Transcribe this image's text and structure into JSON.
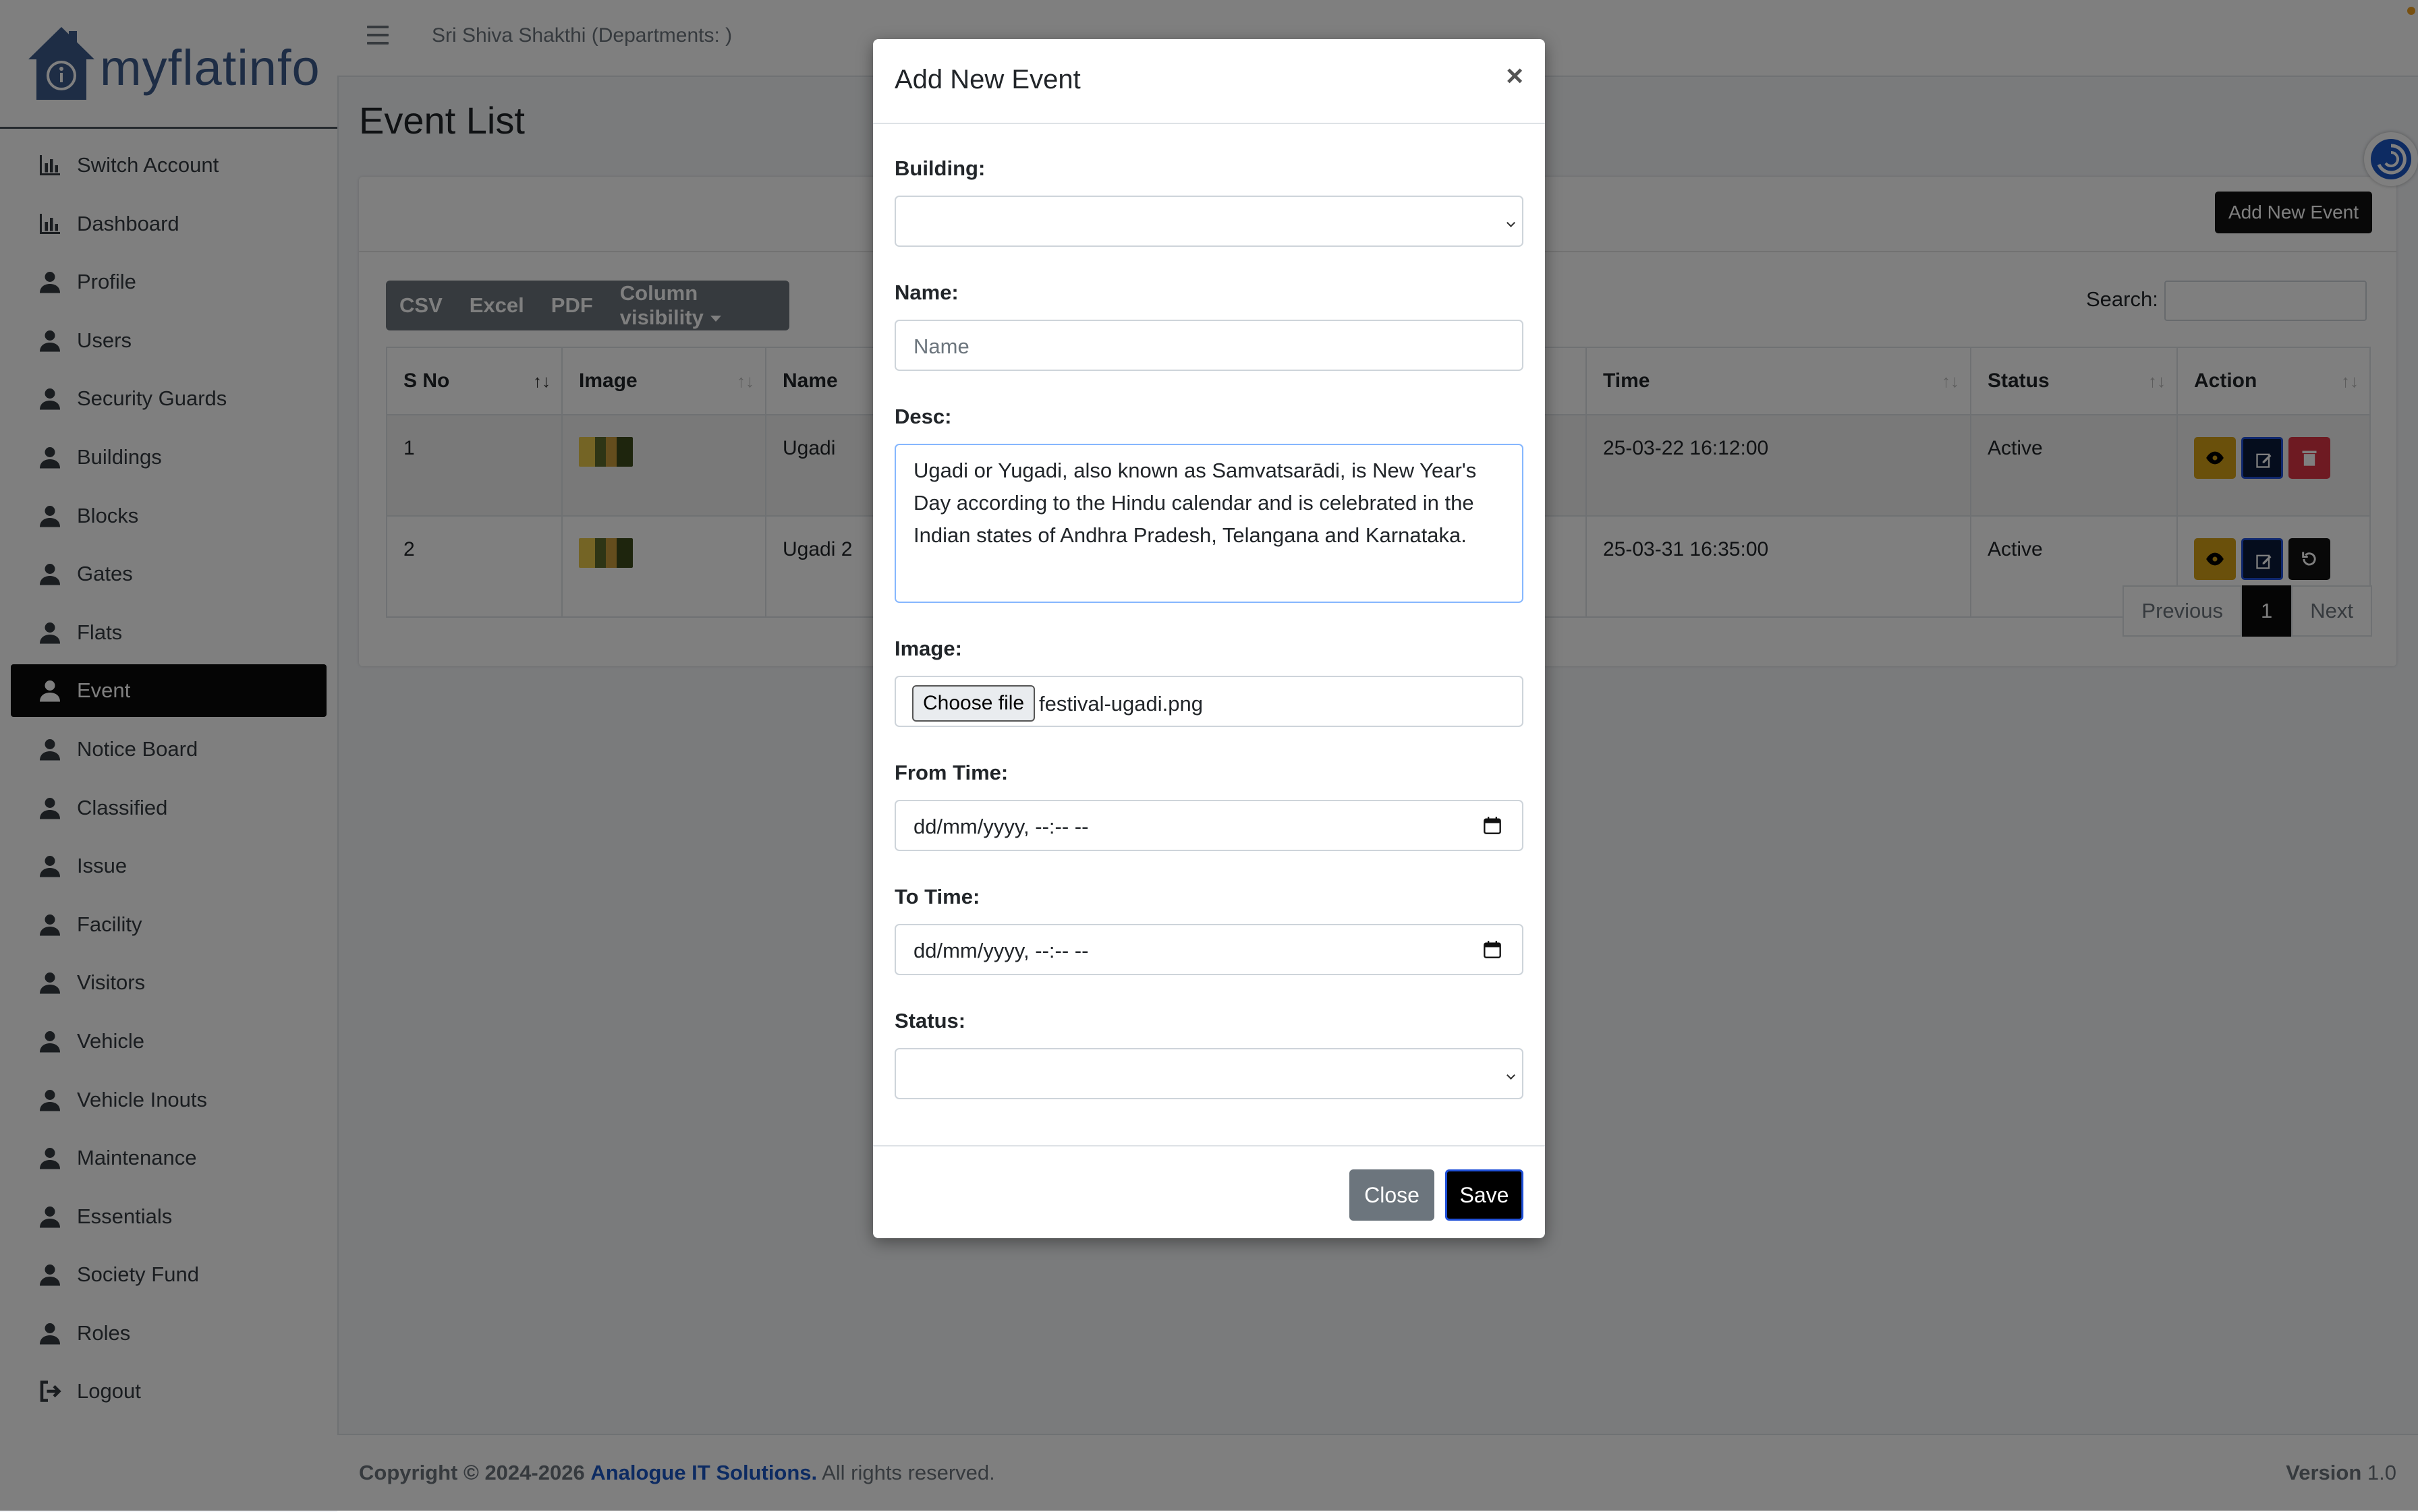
{
  "brand": {
    "name": "myflatinfo"
  },
  "sidebar": {
    "items": [
      {
        "label": "Switch Account",
        "icon": "bar-chart-icon"
      },
      {
        "label": "Dashboard",
        "icon": "bar-chart-icon"
      },
      {
        "label": "Profile",
        "icon": "user-icon"
      },
      {
        "label": "Users",
        "icon": "user-icon"
      },
      {
        "label": "Security Guards",
        "icon": "user-icon"
      },
      {
        "label": "Buildings",
        "icon": "user-icon"
      },
      {
        "label": "Blocks",
        "icon": "user-icon"
      },
      {
        "label": "Gates",
        "icon": "user-icon"
      },
      {
        "label": "Flats",
        "icon": "user-icon"
      },
      {
        "label": "Event",
        "icon": "user-icon",
        "active": true
      },
      {
        "label": "Notice Board",
        "icon": "user-icon"
      },
      {
        "label": "Classified",
        "icon": "user-icon"
      },
      {
        "label": "Issue",
        "icon": "user-icon"
      },
      {
        "label": "Facility",
        "icon": "user-icon"
      },
      {
        "label": "Visitors",
        "icon": "user-icon"
      },
      {
        "label": "Vehicle",
        "icon": "user-icon"
      },
      {
        "label": "Vehicle Inouts",
        "icon": "user-icon"
      },
      {
        "label": "Maintenance",
        "icon": "user-icon"
      },
      {
        "label": "Essentials",
        "icon": "user-icon"
      },
      {
        "label": "Society Fund",
        "icon": "user-icon"
      },
      {
        "label": "Roles",
        "icon": "user-icon"
      },
      {
        "label": "Logout",
        "icon": "logout-icon"
      }
    ]
  },
  "topbar": {
    "title": "Sri Shiva Shakthi (Departments: )"
  },
  "page": {
    "title": "Event List",
    "add_button": "Add New Event",
    "export_buttons": [
      "CSV",
      "Excel",
      "PDF",
      "Column visibility"
    ],
    "search_label": "Search:",
    "table": {
      "columns": [
        "S No",
        "Image",
        "Name",
        "Time",
        "Status",
        "Action"
      ],
      "rows": [
        {
          "sno": "1",
          "name": "Ugadi",
          "time": "25-03-22 16:12:00",
          "status": "Active"
        },
        {
          "sno": "2",
          "name": "Ugadi 2",
          "time": "25-03-31 16:35:00",
          "status": "Active"
        }
      ]
    },
    "pagination": {
      "previous": "Previous",
      "current": "1",
      "next": "Next"
    }
  },
  "footer": {
    "copyright": "Copyright © 2024-2026",
    "company": "Analogue IT Solutions.",
    "rights": "All rights reserved.",
    "version_label": "Version",
    "version": "1.0"
  },
  "modal": {
    "title": "Add New Event",
    "close_symbol": "×",
    "building_label": "Building:",
    "building_value": "",
    "name_label": "Name:",
    "name_placeholder": "Name",
    "desc_label": "Desc:",
    "desc_value": "Ugadi or Yugadi, also known as Samvatsarādi, is New Year's Day according to the Hindu calendar and is celebrated in the Indian states of Andhra Pradesh, Telangana and Karnataka.",
    "image_label": "Image:",
    "choose_file": "Choose file",
    "file_name": "festival-ugadi.png",
    "from_label": "From Time:",
    "from_placeholder": "dd/mm/yyyy, --:-- --",
    "to_label": "To Time:",
    "to_placeholder": "dd/mm/yyyy, --:-- --",
    "status_label": "Status:",
    "status_value": "",
    "close_button": "Close",
    "save_button": "Save"
  },
  "colors": {
    "sidebar_active": "#0b0b0b",
    "brand_blue": "#3c5a8a",
    "view_button": "#d4a017",
    "delete_button": "#dc3545",
    "link_blue": "#1a56c4"
  }
}
